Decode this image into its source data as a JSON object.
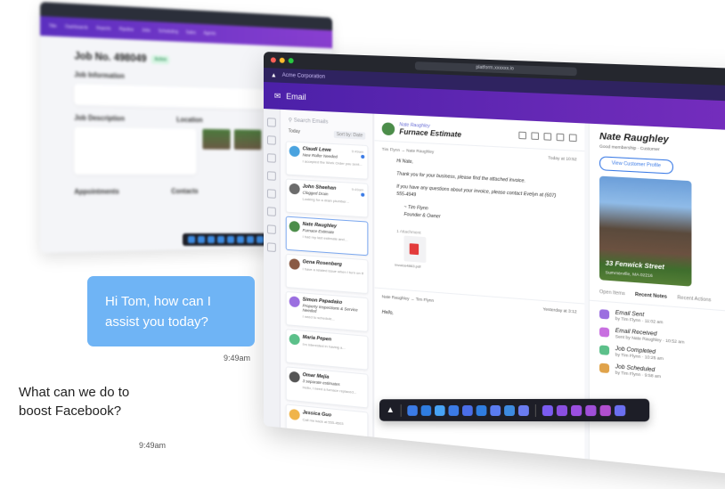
{
  "back_window": {
    "nav_items": [
      "Title",
      "Dashboards",
      "Reports",
      "Pipeline",
      "Jobs",
      "Scheduling",
      "Sales",
      "Agents"
    ],
    "job_title": "Job No. 498049",
    "status_chip": "Active",
    "section_info": "Job Information",
    "section_desc": "Job Description",
    "section_location": "Location",
    "section_appointments": "Appointments",
    "section_contacts": "Contacts"
  },
  "main_window": {
    "url": "platform.xxxxxx.io",
    "company": "Acme Corporation",
    "header_title": "Email",
    "search_placeholder": "Search Emails",
    "today_label": "Today",
    "sort_label": "Sort by: Date",
    "emails": [
      {
        "name": "Claudi Lewe",
        "subject": "New Roller Needed",
        "preview": "I accepted the Work Order you sent...",
        "time": "9:49am",
        "color": "#4aa3df",
        "unread": true
      },
      {
        "name": "John Sheehan",
        "subject": "Clogged Drain",
        "preview": "Looking for a drain plumber...",
        "time": "9:49am",
        "color": "#6b6b6b",
        "unread": true
      },
      {
        "name": "Nate Raughley",
        "subject": "Furnace Estimate",
        "preview": "I had my last estimate and…",
        "time": "",
        "color": "#4c8d4a",
        "unread": false
      },
      {
        "name": "Gena Rosenberg",
        "subject": "",
        "preview": "I have a related issue when I turn on the heat...",
        "time": "",
        "color": "#8a5a44",
        "unread": false
      },
      {
        "name": "Simon Papadako",
        "subject": "Property Inspections & Service Needed",
        "preview": "I need to schedule...",
        "time": "",
        "color": "#9b6fe0",
        "unread": false
      },
      {
        "name": "Maria Pepen",
        "subject": "",
        "preview": "I'm interested in having a...",
        "time": "",
        "color": "#5cc08a",
        "unread": false
      },
      {
        "name": "Omar Mejia",
        "subject": "3 separate estimates",
        "preview": "Hello, I need a furnace replaced...",
        "time": "",
        "color": "#555555",
        "unread": false
      },
      {
        "name": "Jessica Guo",
        "subject": "",
        "preview": "Call me back at 555-4503",
        "time": "",
        "color": "#f0b44a",
        "unread": false
      }
    ],
    "reader": {
      "from": "Nate Raughley",
      "subject": "Furnace Estimate",
      "meta_from": "Tim Flynn → Nate Raughley",
      "meta_time": "Today at 10:52",
      "greeting": "Hi Nate,",
      "body1": "Thank you for your business, please find the attached invoice.",
      "body2": "If you have any questions about your invoice, please contact Evelyn at (607) 555-4949",
      "signature_name": "~ Tim Flynn",
      "signature_title": "Founder & Owner",
      "attachment_label": "1 Attachment",
      "attachment_name": "Invoice4863.pdf",
      "reply_meta": "Nate Raughley → Tim Flynn",
      "reply_time": "Yesterday at 3:12",
      "reply_greeting": "Hello,"
    },
    "contact": {
      "name": "Nate Raughley",
      "sub": "Good membership · Customer",
      "button": "View Customer Profile",
      "address": "33 Fenwick Street",
      "city": "Summerville, MA 02216",
      "tabs": [
        "Open Items",
        "Recent Notes",
        "Recent Actions"
      ],
      "activity": [
        {
          "title": "Email Sent",
          "sub": "by Tim Flynn · 11:02 am",
          "color": "#9b6fe0"
        },
        {
          "title": "Email Received",
          "sub": "Sent by Nate Raughley · 10:52 am",
          "color": "#c86fe0"
        },
        {
          "title": "Job Completed",
          "sub": "by Tim Flynn · 10:25 am",
          "color": "#5cc08a"
        },
        {
          "title": "Job Scheduled",
          "sub": "by Tim Flynn · 9:58 am",
          "color": "#e0a34a"
        }
      ]
    }
  },
  "dock_colors": [
    "#3b7be6",
    "#2f7de0",
    "#47a3f5",
    "#3b7be6",
    "#4a6ee8",
    "#2f7de0",
    "#5a7cf0",
    "#3d8be0",
    "#6a7cf0",
    "#7b5cf0",
    "#8a4fe0",
    "#9b4fe0",
    "#a04fd8",
    "#b24fd0",
    "#6b6ff0"
  ],
  "chat": {
    "agent_message": "Hi Tom, how can I assist you today?",
    "agent_time": "9:49am",
    "user_message": "What can we do to boost Facebook?",
    "user_time": "9:49am"
  }
}
